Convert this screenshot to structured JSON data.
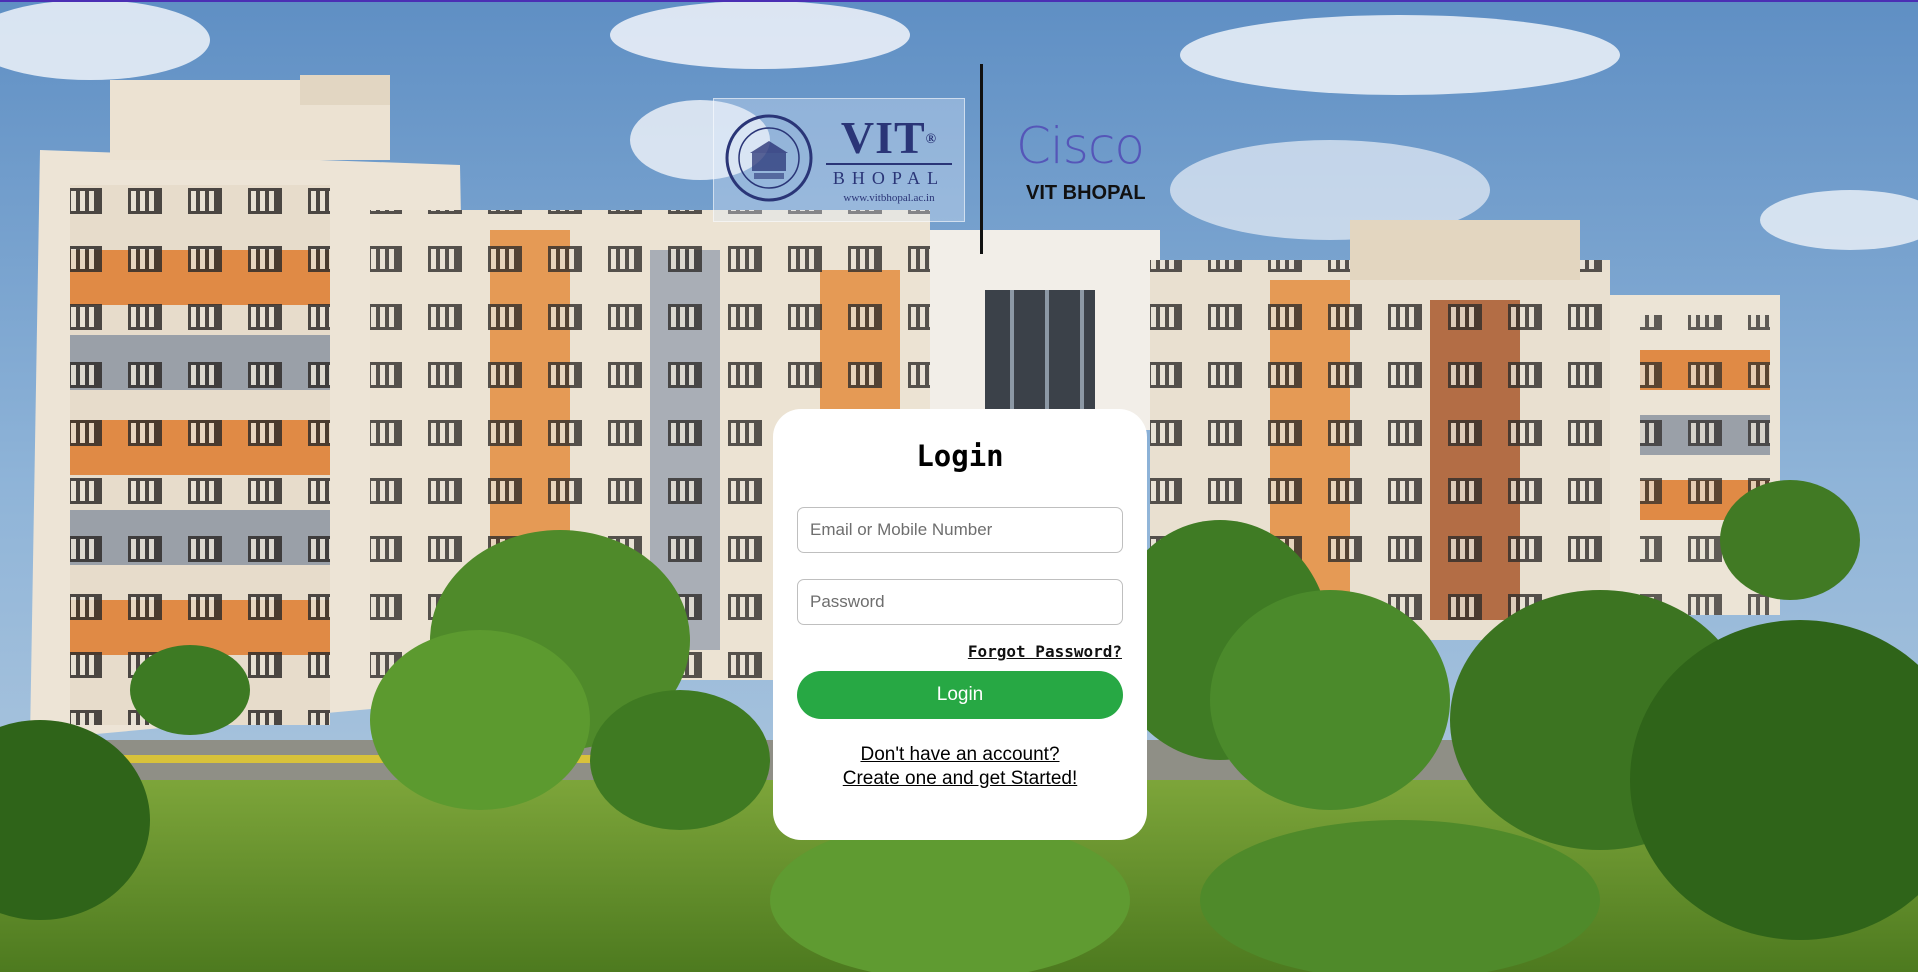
{
  "header": {
    "vit_logo": {
      "seal_text": "VELLORE INSTITUTE OF TECHNOLOGY",
      "seal_initials": "VIT",
      "name": "VIT",
      "registered_mark": "®",
      "campus": "BHOPAL",
      "url": "www.vitbhopal.ac.in"
    },
    "cisco_logo": {
      "brand": "Cisco",
      "subtitle": "VIT BHOPAL"
    }
  },
  "login_form": {
    "title": "Login",
    "email_placeholder": "Email or Mobile Number",
    "email_value": "",
    "password_placeholder": "Password",
    "password_value": "",
    "forgot_password_label": "Forgot Password?",
    "submit_label": "Login",
    "signup_line1": "Don't have an account?",
    "signup_line2": "Create one and get Started!"
  },
  "colors": {
    "accent_green": "#27a844",
    "vit_navy": "#2a3577",
    "cisco_purple": "#5556b8",
    "top_strip": "#4b2fb4"
  }
}
